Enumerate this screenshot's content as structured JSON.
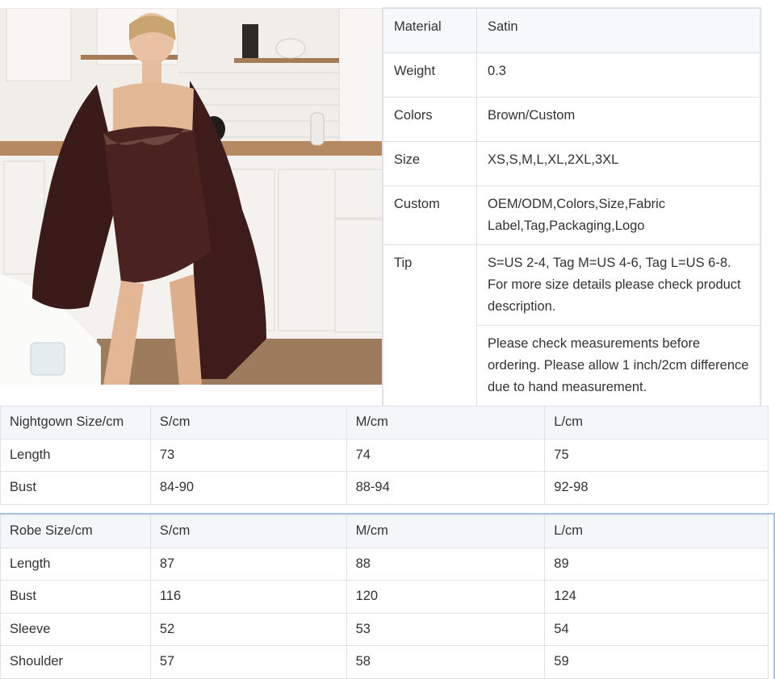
{
  "specs": [
    {
      "label": "Material",
      "value": "Satin"
    },
    {
      "label": "Weight",
      "value": "0.3"
    },
    {
      "label": "Colors",
      "value": "Brown/Custom"
    },
    {
      "label": "Size",
      "value": "XS,S,M,L,XL,2XL,3XL"
    },
    {
      "label": "Custom",
      "value": "OEM/ODM,Colors,Size,Fabric Label,Tag,Packaging,Logo"
    },
    {
      "label": "Tip",
      "value": "S=US 2-4, Tag M=US 4-6, Tag L=US 6-8. For more size details please check product description."
    },
    {
      "label": "",
      "value": "Please check measurements before ordering. Please allow 1 inch/2cm difference due to hand measurement."
    }
  ],
  "nightgown": {
    "headers": [
      "Nightgown Size/cm",
      "S/cm",
      "M/cm",
      "L/cm"
    ],
    "rows": [
      [
        "Length",
        "73",
        "74",
        "75"
      ],
      [
        "Bust",
        "84-90",
        "88-94",
        "92-98"
      ]
    ]
  },
  "robe": {
    "headers": [
      "Robe Size/cm",
      "S/cm",
      "M/cm",
      "L/cm"
    ],
    "rows": [
      [
        "Length",
        "87",
        "88",
        "89"
      ],
      [
        "Bust",
        "116",
        "120",
        "124"
      ],
      [
        "Sleeve",
        "52",
        "53",
        "54"
      ],
      [
        "Shoulder",
        "57",
        "58",
        "59"
      ]
    ]
  },
  "colors": {
    "border": "#dde2e8",
    "header_bg": "#f4f6f9",
    "satin_brown": "#3e1c1c",
    "robe_focus": "#a7c3e6"
  }
}
